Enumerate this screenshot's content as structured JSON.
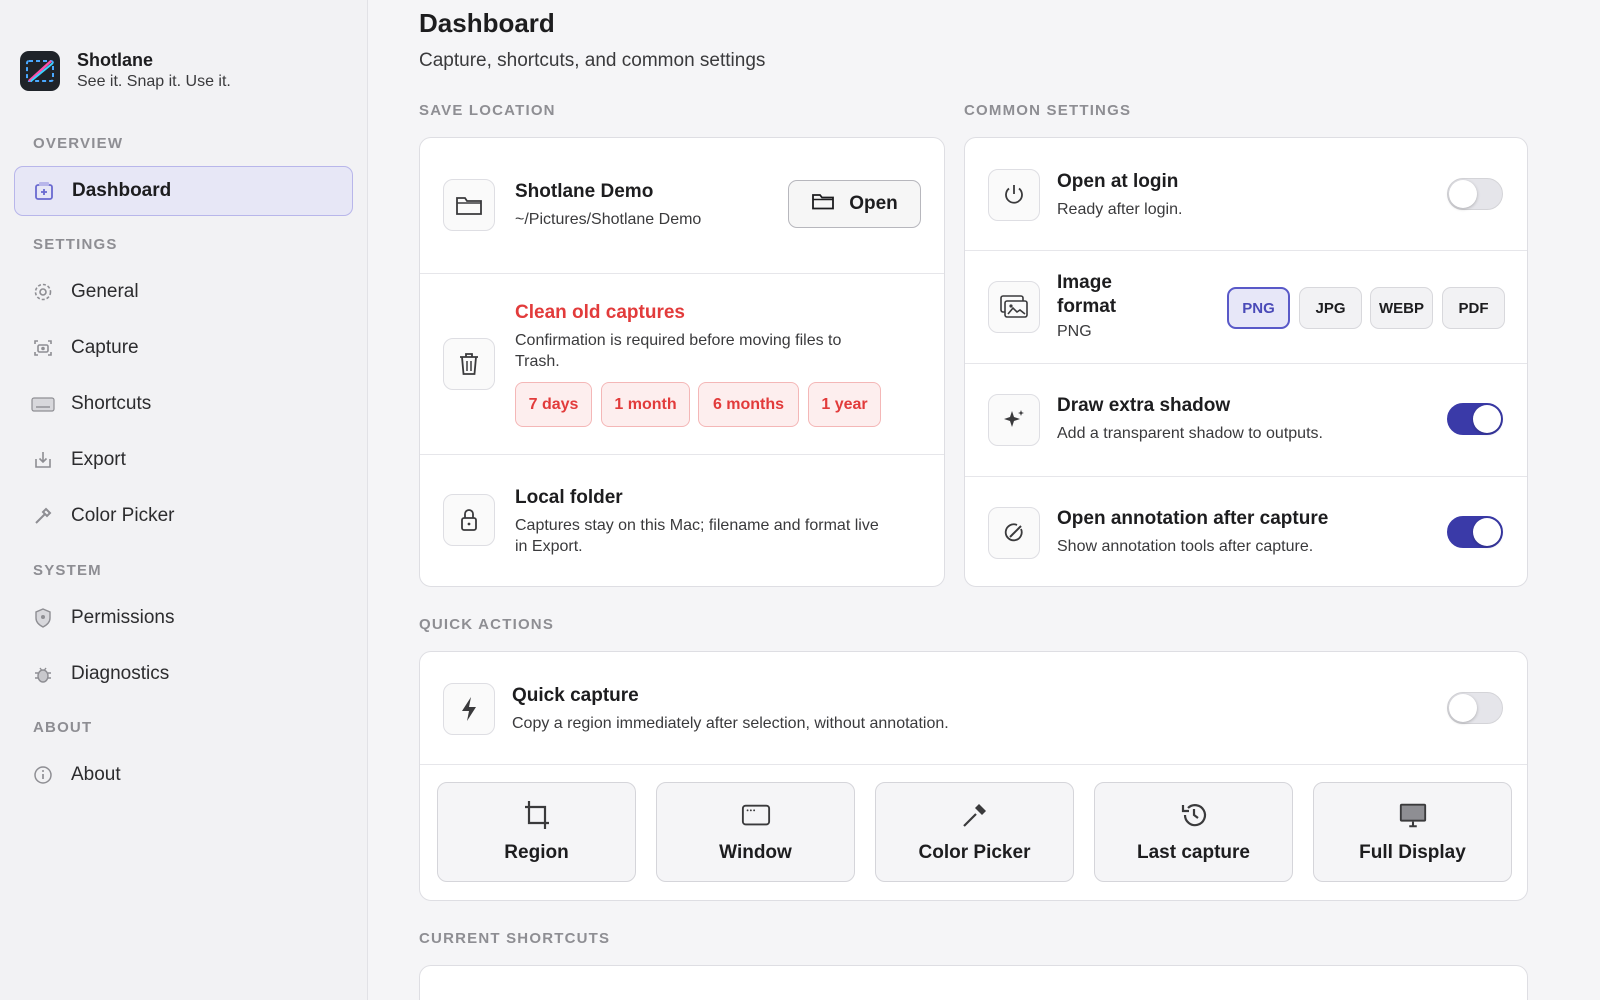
{
  "app": {
    "name": "Shotlane",
    "tagline": "See it. Snap it. Use it."
  },
  "sidebar": {
    "sections": [
      {
        "label": "OVERVIEW"
      },
      {
        "label": "SETTINGS"
      },
      {
        "label": "SYSTEM"
      },
      {
        "label": "ABOUT"
      }
    ],
    "items": [
      {
        "label": "Dashboard",
        "icon": "dashboard-icon",
        "active": true
      },
      {
        "label": "General",
        "icon": "gear-icon"
      },
      {
        "label": "Capture",
        "icon": "camera-icon"
      },
      {
        "label": "Shortcuts",
        "icon": "keyboard-icon"
      },
      {
        "label": "Export",
        "icon": "export-icon"
      },
      {
        "label": "Color Picker",
        "icon": "eyedropper-icon"
      },
      {
        "label": "Permissions",
        "icon": "shield-icon"
      },
      {
        "label": "Diagnostics",
        "icon": "bug-icon"
      },
      {
        "label": "About",
        "icon": "info-icon"
      }
    ]
  },
  "page": {
    "title": "Dashboard",
    "subtitle": "Capture, shortcuts, and common settings"
  },
  "save_location": {
    "label": "SAVE LOCATION",
    "folder_name": "Shotlane Demo",
    "folder_path": "~/Pictures/Shotlane Demo",
    "open_label": "Open",
    "clean_title": "Clean old captures",
    "clean_desc": "Confirmation is required before moving files to Trash.",
    "clean_options": [
      "7 days",
      "1 month",
      "6 months",
      "1 year"
    ],
    "local_title": "Local folder",
    "local_desc": "Captures stay on this Mac; filename and format live in Export."
  },
  "common_settings": {
    "label": "COMMON SETTINGS",
    "open_login": {
      "title": "Open at login",
      "desc": "Ready after login.",
      "enabled": false
    },
    "image_format": {
      "title": "Image format",
      "value": "PNG",
      "options": [
        "PNG",
        "JPG",
        "WEBP",
        "PDF"
      ],
      "selected": "PNG"
    },
    "shadow": {
      "title": "Draw extra shadow",
      "desc": "Add a transparent shadow to outputs.",
      "enabled": true
    },
    "annotation": {
      "title": "Open annotation after capture",
      "desc": "Show annotation tools after capture.",
      "enabled": true
    }
  },
  "quick_actions": {
    "label": "QUICK ACTIONS",
    "quick_capture": {
      "title": "Quick capture",
      "desc": "Copy a region immediately after selection, without annotation.",
      "enabled": false
    },
    "actions": [
      {
        "label": "Region",
        "icon": "crop-icon"
      },
      {
        "label": "Window",
        "icon": "window-icon"
      },
      {
        "label": "Color Picker",
        "icon": "eyedropper-icon"
      },
      {
        "label": "Last capture",
        "icon": "history-icon"
      },
      {
        "label": "Full Display",
        "icon": "monitor-icon"
      }
    ]
  },
  "current_shortcuts": {
    "label": "CURRENT SHORTCUTS"
  },
  "colors": {
    "accent": "#3a3aa8",
    "danger": "#e23b3b"
  }
}
